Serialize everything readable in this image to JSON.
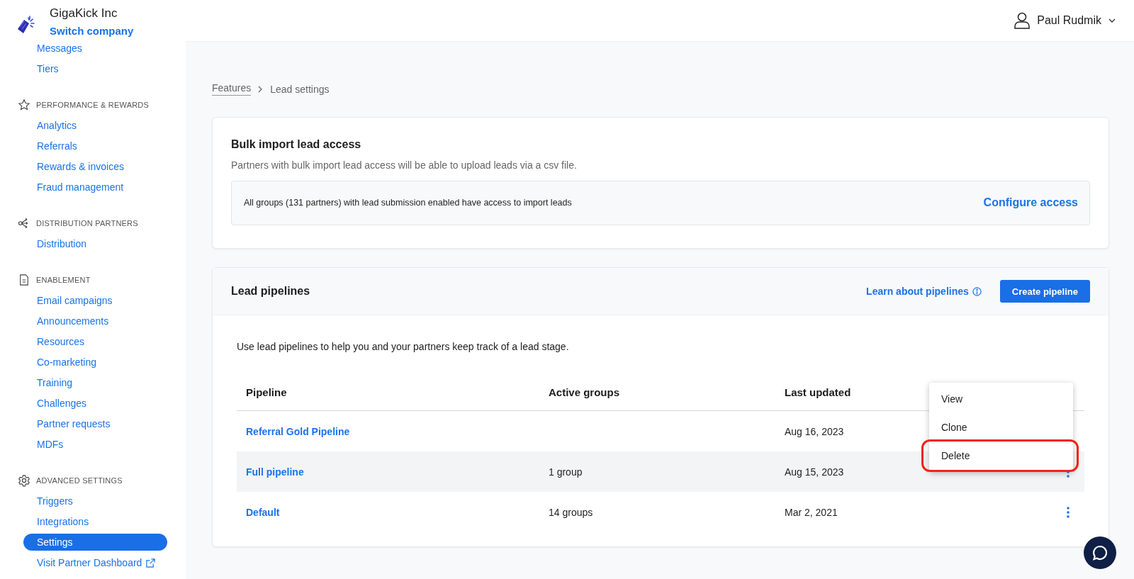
{
  "company": {
    "name": "GigaKick Inc",
    "switch_link": "Switch company"
  },
  "user": {
    "name": "Paul Rudmik"
  },
  "sidebar": {
    "sections": [
      {
        "items": [
          {
            "label": "Messages",
            "selected": false
          },
          {
            "label": "Tiers",
            "selected": false
          }
        ]
      },
      {
        "title": "PERFORMANCE & REWARDS",
        "items": [
          {
            "label": "Analytics",
            "selected": false
          },
          {
            "label": "Referrals",
            "selected": false
          },
          {
            "label": "Rewards & invoices",
            "selected": false
          },
          {
            "label": "Fraud management",
            "selected": false
          }
        ]
      },
      {
        "title": "DISTRIBUTION PARTNERS",
        "items": [
          {
            "label": "Distribution",
            "selected": false
          }
        ]
      },
      {
        "title": "ENABLEMENT",
        "items": [
          {
            "label": "Email campaigns",
            "selected": false
          },
          {
            "label": "Announcements",
            "selected": false
          },
          {
            "label": "Resources",
            "selected": false
          },
          {
            "label": "Co-marketing",
            "selected": false
          },
          {
            "label": "Training",
            "selected": false
          },
          {
            "label": "Challenges",
            "selected": false
          },
          {
            "label": "Partner requests",
            "selected": false
          },
          {
            "label": "MDFs",
            "selected": false
          }
        ]
      },
      {
        "title": "ADVANCED SETTINGS",
        "items": [
          {
            "label": "Triggers",
            "selected": false
          },
          {
            "label": "Integrations",
            "selected": false
          },
          {
            "label": "Settings",
            "selected": true
          },
          {
            "label": "Visit Partner Dashboard",
            "selected": false,
            "external": true
          }
        ]
      }
    ]
  },
  "breadcrumb": [
    "Features",
    "Lead settings"
  ],
  "bulk_import": {
    "title": "Bulk import lead access",
    "description": "Partners with bulk import lead access will be able to upload leads via a csv file.",
    "notice": "All groups (131 partners) with lead submission enabled have access to import leads",
    "action": "Configure access"
  },
  "pipelines": {
    "title": "Lead pipelines",
    "learn_link": "Learn about pipelines",
    "create_button": "Create pipeline",
    "description": "Use lead pipelines to help you and your partners keep track of a lead stage.",
    "columns": [
      "Pipeline",
      "Active groups",
      "Last updated"
    ],
    "rows": [
      {
        "name": "Referral Gold Pipeline",
        "updated": "Aug 16, 2023",
        "hovered": false
      },
      {
        "name": "Full pipeline",
        "groups": "1 group",
        "updated": "Aug 15, 2023",
        "hovered": true
      },
      {
        "name": "Default",
        "groups": "14 groups",
        "updated": "Mar 2, 2021",
        "hovered": false
      }
    ],
    "menu": [
      {
        "label": "View",
        "highlighted": false
      },
      {
        "label": "Clone",
        "highlighted": false
      },
      {
        "label": "Delete",
        "highlighted": true
      }
    ]
  }
}
